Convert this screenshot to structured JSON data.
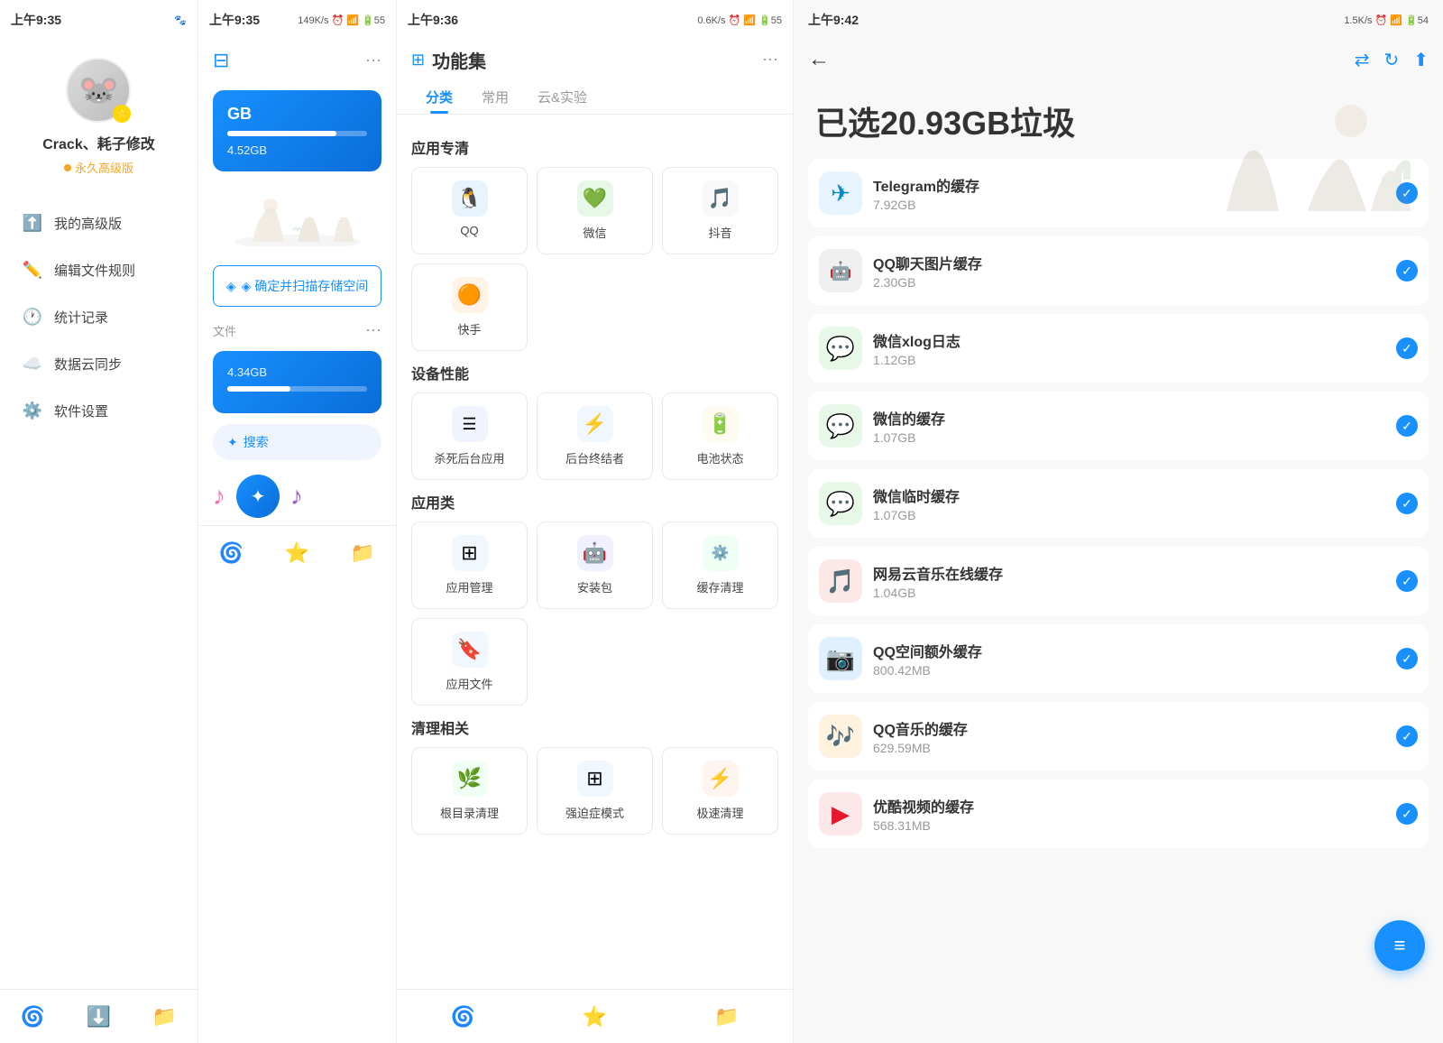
{
  "panel1": {
    "status_time": "上午9:35",
    "status_right": "🐾 ✦",
    "username": "Crack、耗子修改",
    "user_level": "永久高级版",
    "avatar_emoji": "🐭",
    "menu_items": [
      {
        "icon": "⬆️",
        "label": "我的高级版"
      },
      {
        "icon": "✏️",
        "label": "编辑文件规则"
      },
      {
        "icon": "🕐",
        "label": "统计记录"
      },
      {
        "icon": "☁️",
        "label": "数据云同步"
      },
      {
        "icon": "⚙️",
        "label": "软件设置"
      }
    ],
    "nav_icon": "🌀"
  },
  "panel2": {
    "status_time": "上午9:35",
    "status_right": "149K/s 🕐 📶 📶 🔋55",
    "storage1_label": "GB",
    "storage1_sub": "4.52GB",
    "storage2_sub": "4.34GB",
    "file_section": "文件",
    "search_label": "✦ 搜索",
    "scan_btn": "◈ 确定并扫描存储空间",
    "more_dots": "⋯"
  },
  "panel3": {
    "status_time": "上午9:36",
    "status_right": "0.6K/s 🕐 📶 📶 🔋55",
    "title": "功能集",
    "tabs": [
      "分类",
      "常用",
      "云&实验"
    ],
    "active_tab": "分类",
    "sections": [
      {
        "title": "应用专清",
        "items": [
          {
            "icon": "🐧",
            "label": "QQ",
            "bg": "#f0f7ff"
          },
          {
            "icon": "💚",
            "label": "微信",
            "bg": "#f0fff4"
          },
          {
            "icon": "🎵",
            "label": "抖音",
            "bg": "#fff0f0"
          },
          {
            "icon": "🟠",
            "label": "快手",
            "bg": "#fff5f0"
          }
        ]
      },
      {
        "title": "设备性能",
        "items": [
          {
            "icon": "☰",
            "label": "杀死后台应用",
            "bg": "#f0f7ff"
          },
          {
            "icon": "⚡",
            "label": "后台终结者",
            "bg": "#f0f7ff"
          },
          {
            "icon": "🔋",
            "label": "电池状态",
            "bg": "#fffbf0"
          }
        ]
      },
      {
        "title": "应用类",
        "items": [
          {
            "icon": "⊞",
            "label": "应用管理",
            "bg": "#f0f7ff"
          },
          {
            "icon": "📦",
            "label": "安装包",
            "bg": "#f0f0ff"
          },
          {
            "icon": "🔄",
            "label": "缓存清理",
            "bg": "#f0fff4"
          },
          {
            "icon": "🔖",
            "label": "应用文件",
            "bg": "#f0f7ff"
          }
        ]
      },
      {
        "title": "清理相关",
        "items": [
          {
            "icon": "🌿",
            "label": "根目录清理",
            "bg": "#f0fff4"
          },
          {
            "icon": "⊞",
            "label": "强迫症模式",
            "bg": "#f0f7ff"
          },
          {
            "icon": "⚡",
            "label": "极速清理",
            "bg": "#fff5f0"
          }
        ]
      }
    ]
  },
  "panel4": {
    "status_time": "上午9:42",
    "status_right": "1.5K/s 🕐 📶 📶 🔋54",
    "hero_title": "已选20.93GB垃圾",
    "junk_items": [
      {
        "name": "Telegram的缓存",
        "size": "7.92GB",
        "icon": "✈️",
        "bg": "#e8f4fd",
        "color": "#0088cc"
      },
      {
        "name": "QQ聊天图片缓存",
        "size": "2.30GB",
        "icon": "🤖",
        "bg": "#f0f0f0",
        "color": "#444"
      },
      {
        "name": "微信xlog日志",
        "size": "1.12GB",
        "icon": "💚",
        "bg": "#e8f8e8",
        "color": "#07c160"
      },
      {
        "name": "微信的缓存",
        "size": "1.07GB",
        "icon": "💚",
        "bg": "#e8f8e8",
        "color": "#07c160"
      },
      {
        "name": "微信临时缓存",
        "size": "1.07GB",
        "icon": "💚",
        "bg": "#e8f8e8",
        "color": "#07c160"
      },
      {
        "name": "网易云音乐在线缓存",
        "size": "1.04GB",
        "icon": "🎵",
        "bg": "#fde8e8",
        "color": "#e60012"
      },
      {
        "name": "QQ空间额外缓存",
        "size": "800.42MB",
        "icon": "📸",
        "bg": "#e0f0ff",
        "color": "#4a90d9"
      },
      {
        "name": "QQ音乐的缓存",
        "size": "629.59MB",
        "icon": "🎶",
        "bg": "#fff3e0",
        "color": "#ff6c00"
      },
      {
        "name": "优酷视频的缓存",
        "size": "568.31MB",
        "icon": "▶️",
        "bg": "#fce8e8",
        "color": "#e6162d"
      }
    ],
    "fab_icon": "≡"
  }
}
